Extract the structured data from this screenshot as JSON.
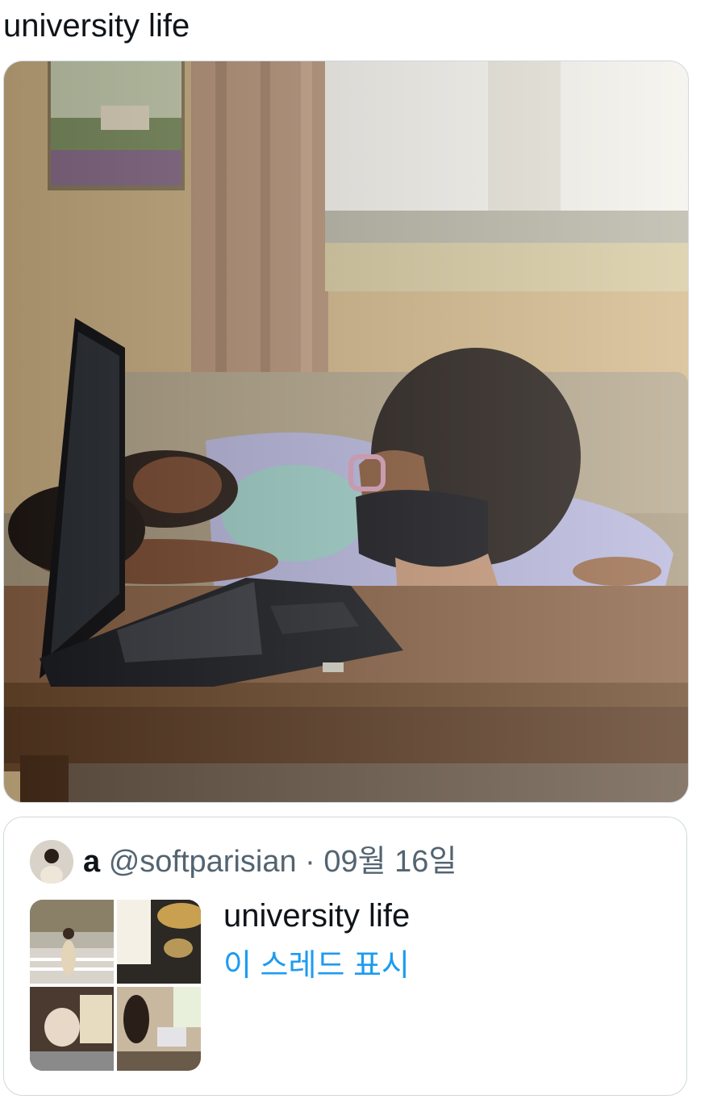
{
  "tweet": {
    "text": "university life"
  },
  "quoted_tweet": {
    "display_name": "a",
    "handle": "@softparisian",
    "separator": "·",
    "date": "09월 16일",
    "text": "university life",
    "show_thread_label": "이 스레드 표시"
  },
  "colors": {
    "text_primary": "#0f1419",
    "text_secondary": "#536471",
    "link": "#1d9bf0",
    "border": "#cfd9de"
  }
}
